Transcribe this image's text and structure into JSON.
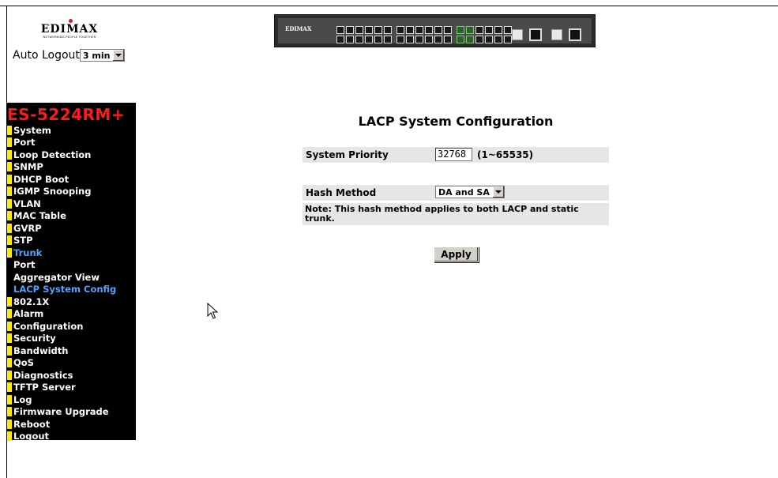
{
  "brand": {
    "name": "EDIMAX",
    "tagline": "NETWORKING PEOPLE TOGETHER",
    "switch_label": "EDIMAX"
  },
  "session": {
    "auto_logout_label": "Auto Logout",
    "auto_logout_value": "3 min"
  },
  "sidebar": {
    "model": "ES-5224RM+",
    "items": [
      {
        "label": "System",
        "state": "normal"
      },
      {
        "label": "Port",
        "state": "normal"
      },
      {
        "label": "Loop Detection",
        "state": "normal"
      },
      {
        "label": "SNMP",
        "state": "normal"
      },
      {
        "label": "DHCP Boot",
        "state": "normal"
      },
      {
        "label": "IGMP Snooping",
        "state": "normal"
      },
      {
        "label": "VLAN",
        "state": "normal"
      },
      {
        "label": "MAC Table",
        "state": "normal"
      },
      {
        "label": "GVRP",
        "state": "normal"
      },
      {
        "label": "STP",
        "state": "normal"
      },
      {
        "label": "Trunk",
        "state": "active"
      },
      {
        "label": "Port",
        "state": "sub"
      },
      {
        "label": "Aggregator View",
        "state": "sub"
      },
      {
        "label": "LACP System Config",
        "state": "sub-active"
      },
      {
        "label": "802.1X",
        "state": "normal"
      },
      {
        "label": "Alarm",
        "state": "normal"
      },
      {
        "label": "Configuration",
        "state": "normal"
      },
      {
        "label": "Security",
        "state": "normal"
      },
      {
        "label": "Bandwidth",
        "state": "normal"
      },
      {
        "label": "QoS",
        "state": "normal"
      },
      {
        "label": "Diagnostics",
        "state": "normal"
      },
      {
        "label": "TFTP Server",
        "state": "normal"
      },
      {
        "label": "Log",
        "state": "normal"
      },
      {
        "label": "Firmware Upgrade",
        "state": "normal"
      },
      {
        "label": "Reboot",
        "state": "normal"
      },
      {
        "label": "Logout",
        "state": "normal"
      }
    ]
  },
  "main": {
    "title": "LACP System Configuration",
    "system_priority": {
      "label": "System Priority",
      "value": "32768",
      "range": "(1~65535)"
    },
    "hash_method": {
      "label": "Hash Method",
      "value": "DA and SA"
    },
    "note": "Note: This hash method applies to both LACP and static trunk.",
    "apply_label": "Apply"
  },
  "colors": {
    "sidebar_bg": "#000000",
    "model_red": "#ff1a1a",
    "bullet_yellow": "#ffea00",
    "active_blue": "#4fa3ff",
    "row_gray": "#e6e6e6"
  }
}
